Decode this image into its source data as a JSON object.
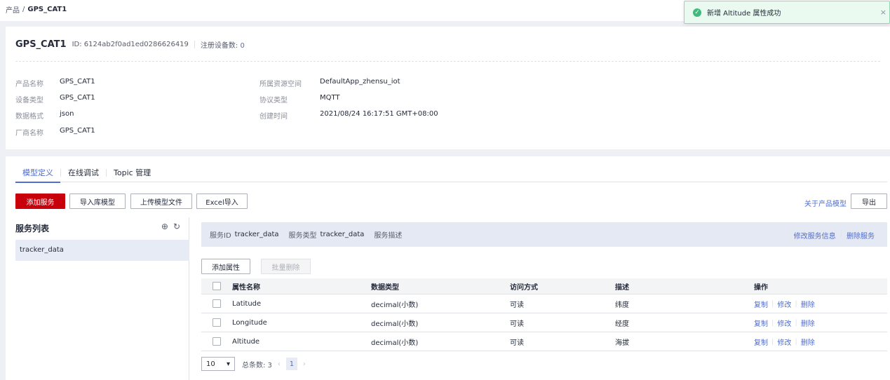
{
  "breadcrumb": {
    "parent": "产品",
    "sep": "/",
    "current": "GPS_CAT1"
  },
  "toast": {
    "message": "新增 Altitude 属性成功",
    "close": "×"
  },
  "product": {
    "name": "GPS_CAT1",
    "id_label": "ID: 6124ab2f0ad1ed0286626419",
    "registered_label": "注册设备数:",
    "registered_count": "0",
    "fields_left": [
      {
        "key": "产品名称",
        "value": "GPS_CAT1"
      },
      {
        "key": "设备类型",
        "value": "GPS_CAT1"
      },
      {
        "key": "数据格式",
        "value": "json"
      },
      {
        "key": "厂商名称",
        "value": "GPS_CAT1"
      }
    ],
    "fields_right": [
      {
        "key": "所属资源空间",
        "value": "DefaultApp_zhensu_iot"
      },
      {
        "key": "协议类型",
        "value": "MQTT"
      },
      {
        "key": "创建时间",
        "value": "2021/08/24 16:17:51 GMT+08:00"
      }
    ]
  },
  "tabs": [
    {
      "label": "模型定义",
      "active": true
    },
    {
      "label": "在线调试",
      "active": false
    },
    {
      "label": "Topic 管理",
      "active": false
    }
  ],
  "toolbar": {
    "add_service": "添加服务",
    "import_library": "导入库模型",
    "upload_model": "上传模型文件",
    "excel_import": "Excel导入",
    "about_model": "关于产品模型",
    "export": "导出"
  },
  "service_list": {
    "title": "服务列表",
    "items": [
      "tracker_data"
    ]
  },
  "service_info": {
    "id_label": "服务ID",
    "id_value": "tracker_data",
    "type_label": "服务类型",
    "type_value": "tracker_data",
    "desc_label": "服务描述",
    "desc_value": "",
    "edit_link": "修改服务信息",
    "delete_link": "删除服务"
  },
  "property_actions": {
    "add": "添加属性",
    "batch_delete": "批量删除"
  },
  "table": {
    "headers": [
      "属性名称",
      "数据类型",
      "访问方式",
      "描述",
      "操作"
    ],
    "rows": [
      {
        "name": "Latitude",
        "type": "decimal(小数)",
        "access": "可读",
        "desc": "纬度"
      },
      {
        "name": "Longitude",
        "type": "decimal(小数)",
        "access": "可读",
        "desc": "经度"
      },
      {
        "name": "Altitude",
        "type": "decimal(小数)",
        "access": "可读",
        "desc": "海拔"
      }
    ],
    "ops": {
      "copy": "复制",
      "edit": "修改",
      "delete": "删除"
    }
  },
  "pager": {
    "page_size": "10",
    "total_label": "总条数: 3",
    "current_page": "1"
  },
  "colors": {
    "primary": "#c7000b",
    "link": "#526ecc",
    "success": "#3fbb7a"
  }
}
